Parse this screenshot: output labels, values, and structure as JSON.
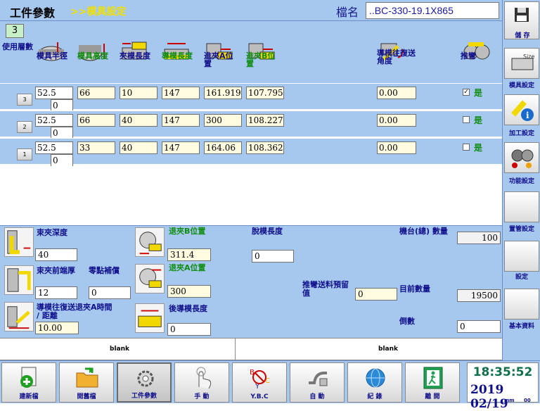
{
  "header": {
    "title": "工件參數",
    "subtitle": ">>模具設定",
    "file_label": "檔名",
    "file_name": "..BC-330-19.1X865"
  },
  "layers": {
    "count": "3",
    "label": "使用層數"
  },
  "columns": {
    "radius": "模具半徑",
    "height": "模具高度",
    "clamp_len": "夾模長度",
    "guide_len": "導模長度",
    "in_a": "進夾A位置",
    "in_b": "進夾B位置",
    "return_angle": "導模往復送角度",
    "push_bend": "推彎"
  },
  "rows": [
    {
      "btn": "3",
      "radius": "52.5",
      "sub": "0",
      "height": "66",
      "clamp": "10",
      "guide": "147",
      "in_a": "161.919",
      "in_b": "107.795",
      "angle": "0.00",
      "checked": "✓",
      "push": "是"
    },
    {
      "btn": "2",
      "radius": "52.5",
      "sub": "0",
      "height": "66",
      "clamp": "40",
      "guide": "147",
      "in_a": "300",
      "in_b": "108.227",
      "angle": "0.00",
      "checked": "",
      "push": "是"
    },
    {
      "btn": "1",
      "radius": "52.5",
      "sub": "0",
      "height": "33",
      "clamp": "40",
      "guide": "147",
      "in_a": "164.06",
      "in_b": "108.362",
      "angle": "0.00",
      "checked": "",
      "push": "是"
    }
  ],
  "bottom": {
    "clamp_depth_label": "束夾深度",
    "clamp_depth": "40",
    "clamp_thick_label": "束夾前端厚",
    "clamp_thick": "12",
    "zero_comp_label": "零點補償",
    "zero_comp": "0",
    "return_time_label": "導模往復送退夾A時間 / 距離",
    "return_time": "10.00",
    "retreat_b_label": "退夾B位置",
    "retreat_b": "311.4",
    "retreat_a_label": "退夾A位置",
    "retreat_a": "300",
    "rear_guide_label": "後導模長度",
    "rear_guide": "0",
    "off_mold_label": "脫模長度",
    "off_mold": "0",
    "push_feed_label": "推彎送料預留值",
    "push_feed": "0",
    "machine_label": "機台(總) 數量",
    "machine": "100",
    "current_label": "目前數量",
    "current": "19500",
    "countdown_label": "倒數",
    "countdown": "0"
  },
  "blank": {
    "left": "blank",
    "right": "blank"
  },
  "sidebar": {
    "save": "儲 存",
    "mold": "模具設定",
    "process": "加工設定",
    "function": "功能設定",
    "pipe": "置管設定",
    "settings": "設定",
    "basic": "基本資料"
  },
  "toolbar": {
    "new": "建新檔",
    "open": "開舊檔",
    "params": "工件參數",
    "manual": "手  動",
    "ybc": "Y.B.C",
    "auto": "自  動",
    "record": "紀  錄",
    "exit": "離  開"
  },
  "clock": {
    "time": "18:35:52",
    "date": "2019 02/19",
    "mm": "mm",
    "dd": "00"
  },
  "colors": {
    "panel": "#a6c8ee",
    "title_yellow": "#f0e000",
    "label_blue": "#10108c",
    "label_green": "#108c10"
  }
}
